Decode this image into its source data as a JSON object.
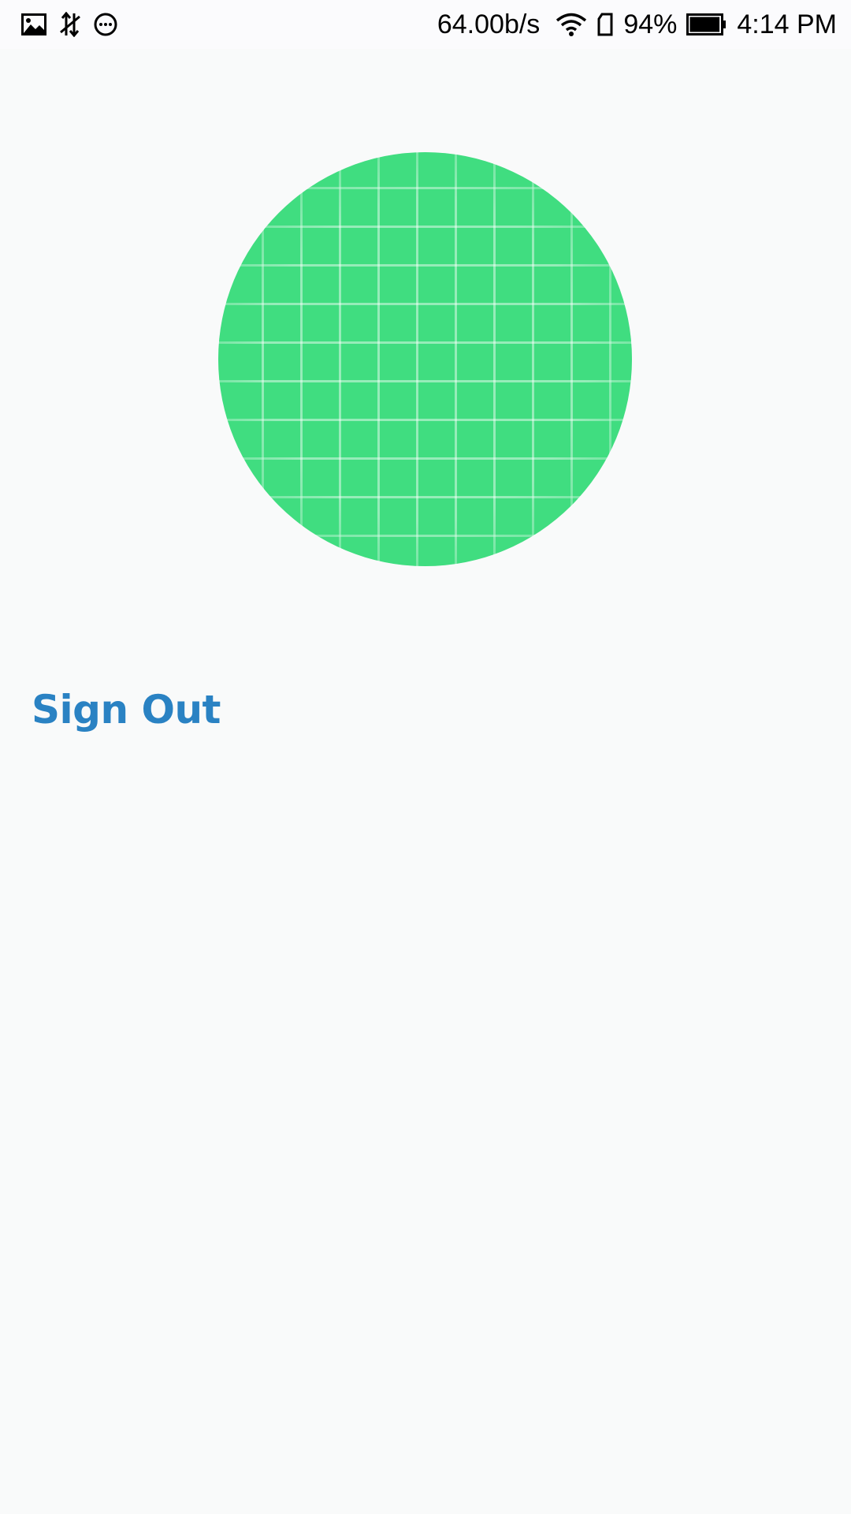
{
  "status_bar": {
    "left_icons": [
      "image-icon",
      "data-sync-icon",
      "message-bubble-icon"
    ],
    "network_speed": "64.00b/s",
    "battery_percent": "94%",
    "battery_level": 0.94,
    "time": "4:14 PM",
    "right_icons": [
      "wifi-icon",
      "sd-card-icon",
      "battery-icon"
    ]
  },
  "profile": {
    "avatar_color": "#40dd80",
    "avatar_icon": "green-grid-avatar"
  },
  "actions": {
    "sign_out_label": "Sign Out",
    "sign_out_color": "#2a82c3"
  }
}
